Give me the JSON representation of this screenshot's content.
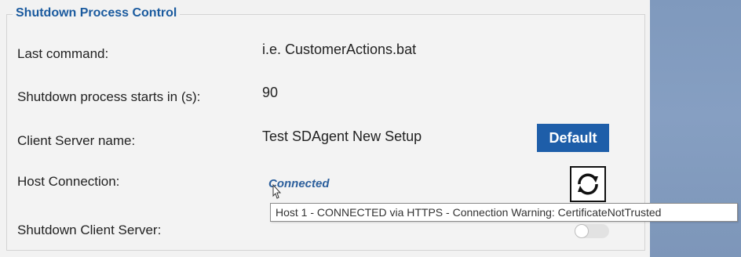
{
  "group": {
    "title": "Shutdown Process Control"
  },
  "rows": {
    "last_command": {
      "label": "Last command:",
      "value": "i.e. CustomerActions.bat"
    },
    "shutdown_delay": {
      "label": "Shutdown process starts in (s):",
      "value": "90"
    },
    "client_server_name": {
      "label": "Client Server name:",
      "value": "Test SDAgent New Setup",
      "button_label": "Default"
    },
    "host_connection": {
      "label": "Host Connection:",
      "status": "Connected",
      "refresh_icon": "refresh-icon"
    },
    "shutdown_client_server": {
      "label": "Shutdown Client Server:",
      "toggle_on": false
    }
  },
  "tooltip": {
    "text": "Host 1 - CONNECTED via HTTPS - Connection Warning: CertificateNotTrusted"
  },
  "colors": {
    "accent": "#1e5ea9",
    "title": "#1a5a9e",
    "link": "#2c5f9c",
    "side_panel": "#8099bd"
  }
}
